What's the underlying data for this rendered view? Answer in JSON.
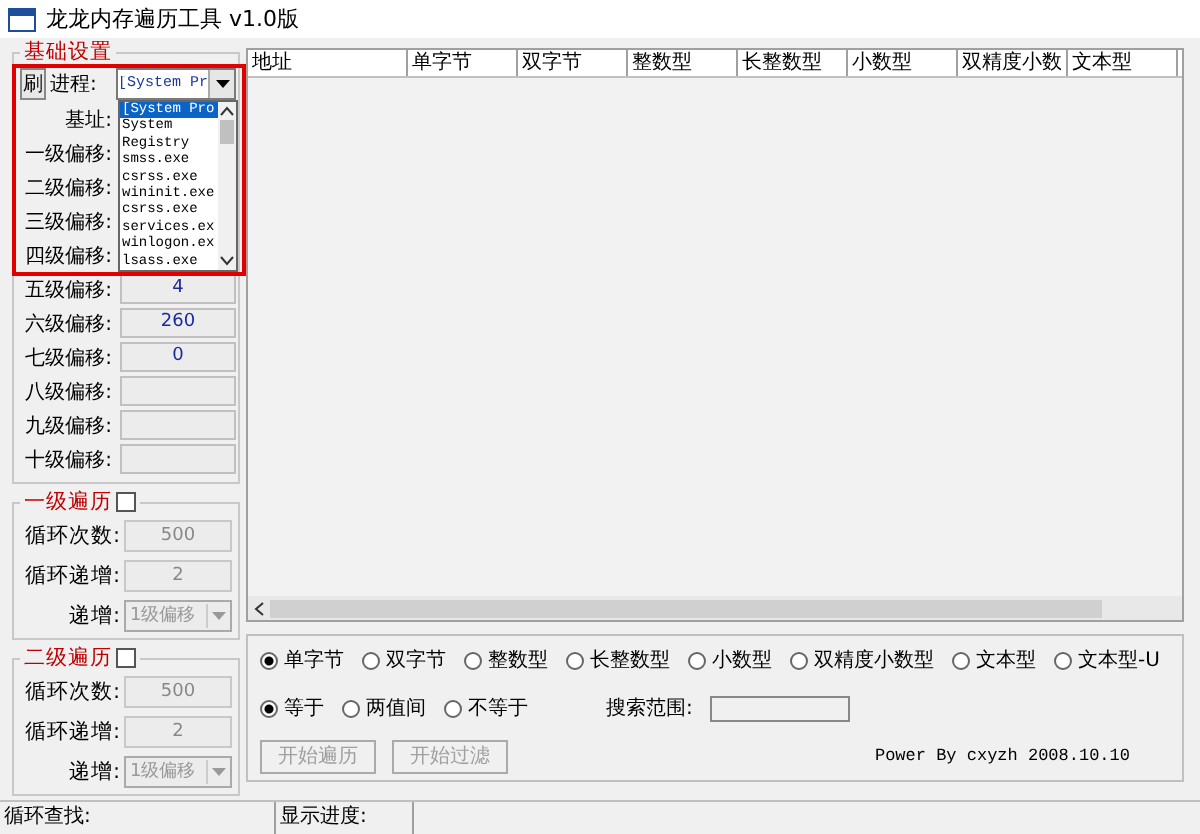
{
  "window": {
    "title": "龙龙内存遍历工具 v1.0版"
  },
  "basic_settings": {
    "title": "基础设置",
    "refresh_button": "刷",
    "process": {
      "label": "进程:",
      "value": "[System Pr",
      "expanded": true,
      "options": [
        {
          "label": "[System Pro",
          "selected": true
        },
        {
          "label": "System",
          "selected": false
        },
        {
          "label": "Registry",
          "selected": false
        },
        {
          "label": "smss.exe",
          "selected": false
        },
        {
          "label": "csrss.exe",
          "selected": false
        },
        {
          "label": "wininit.exe",
          "selected": false
        },
        {
          "label": "csrss.exe",
          "selected": false
        },
        {
          "label": "services.ex",
          "selected": false
        },
        {
          "label": "winlogon.ex",
          "selected": false
        },
        {
          "label": "lsass.exe",
          "selected": false
        }
      ]
    },
    "fields": [
      {
        "label": "基址:"
      },
      {
        "label": "一级偏移:"
      },
      {
        "label": "二级偏移:"
      },
      {
        "label": "三级偏移:"
      },
      {
        "label": "四级偏移:"
      },
      {
        "label": "五级偏移:",
        "value": "4"
      },
      {
        "label": "六级偏移:",
        "value": "260"
      },
      {
        "label": "七级偏移:",
        "value": "0"
      },
      {
        "label": "八级偏移:"
      },
      {
        "label": "九级偏移:"
      },
      {
        "label": "十级偏移:"
      }
    ]
  },
  "traversal_groups": [
    {
      "title": "一级遍历",
      "checked": false,
      "count_label": "循环次数:",
      "count_value": "500",
      "step_label": "循环递增:",
      "step_value": "2",
      "increment_label": "递增:",
      "increment_value": "1级偏移",
      "disabled": true
    },
    {
      "title": "二级遍历",
      "checked": false,
      "count_label": "循环次数:",
      "count_value": "500",
      "step_label": "循环递增:",
      "step_value": "2",
      "increment_label": "递增:",
      "increment_value": "1级偏移",
      "disabled": true
    }
  ],
  "table": {
    "columns": [
      "地址",
      "单字节",
      "双字节",
      "整数型",
      "长整数型",
      "小数型",
      "双精度小数",
      "文本型"
    ]
  },
  "value_types": [
    {
      "label": "单字节",
      "selected": true
    },
    {
      "label": "双字节",
      "selected": false
    },
    {
      "label": "整数型",
      "selected": false
    },
    {
      "label": "长整数型",
      "selected": false
    },
    {
      "label": "小数型",
      "selected": false
    },
    {
      "label": "双精度小数型",
      "selected": false
    },
    {
      "label": "文本型",
      "selected": false
    },
    {
      "label": "文本型-U",
      "selected": false
    }
  ],
  "comparisons": [
    {
      "label": "等于",
      "selected": true
    },
    {
      "label": "两值间",
      "selected": false
    },
    {
      "label": "不等于",
      "selected": false
    }
  ],
  "search_range": {
    "label": "搜索范围:"
  },
  "buttons": [
    {
      "label": "开始遍历",
      "disabled": true
    },
    {
      "label": "开始过滤",
      "disabled": true
    }
  ],
  "credit": "Power By cxyzh 2008.10.10",
  "status_bar": [
    "循环查找:",
    "显示进度:"
  ]
}
